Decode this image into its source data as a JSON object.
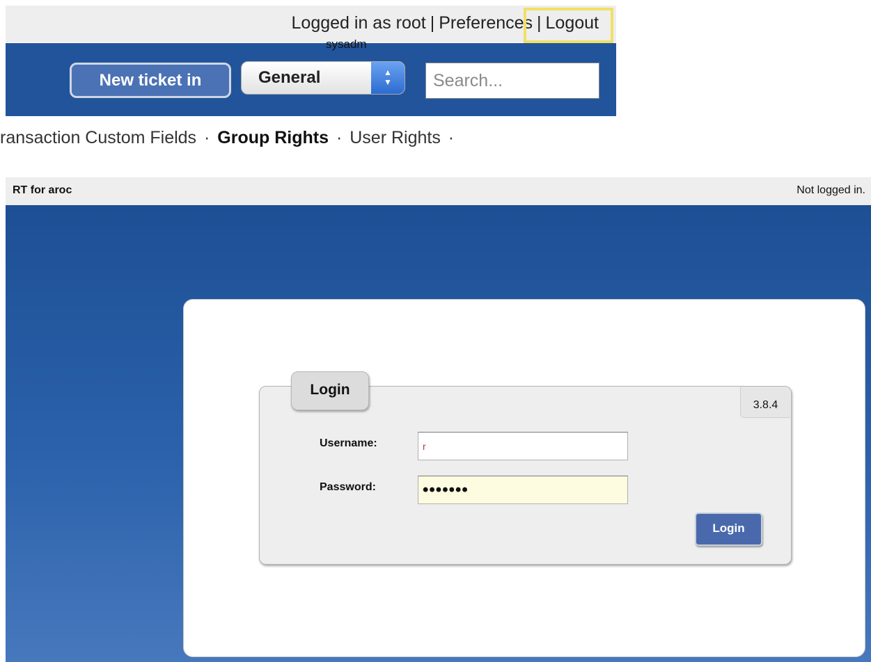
{
  "top_header": {
    "logged_in_text": "Logged in as root",
    "separator": "|",
    "preferences_link": "Preferences",
    "logout_link": "Logout",
    "sysadm_label": "sysadm"
  },
  "toolbar": {
    "new_ticket_label": "New ticket in",
    "queue_selected": "General",
    "search_placeholder": "Search..."
  },
  "rights_nav": {
    "transaction_custom_fields": "ransaction Custom Fields",
    "group_rights": "Group Rights",
    "user_rights": "User Rights",
    "separator": "·"
  },
  "rt_header": {
    "title": "RT for aroc",
    "status": "Not logged in."
  },
  "login_form": {
    "tab_title": "Login",
    "version": "3.8.4",
    "username_label": "Username:",
    "username_value": "r",
    "password_label": "Password:",
    "password_value": "•••••••",
    "submit_label": "Login"
  },
  "colors": {
    "brand_blue": "#22549b",
    "highlight_yellow": "#f0e067",
    "password_field_bg": "#fdfbe0"
  }
}
